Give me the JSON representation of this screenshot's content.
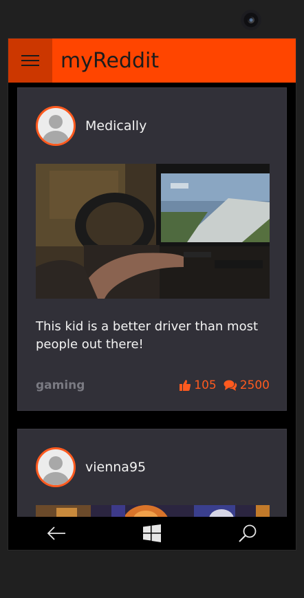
{
  "app": {
    "title": "myReddit"
  },
  "posts": [
    {
      "author": "Medically",
      "title": "This kid is a better driver than most people out there!",
      "subreddit": "gaming",
      "upvotes": "105",
      "comments": "2500"
    },
    {
      "author": "vienna95"
    }
  ],
  "colors": {
    "accent": "#ff4500",
    "card": "#313038",
    "background": "#000000"
  },
  "icons": {
    "menu": "hamburger-icon",
    "back": "back-arrow-icon",
    "home": "windows-logo-icon",
    "search": "search-icon",
    "upvote": "thumbs-up-icon",
    "comments": "comments-icon"
  }
}
